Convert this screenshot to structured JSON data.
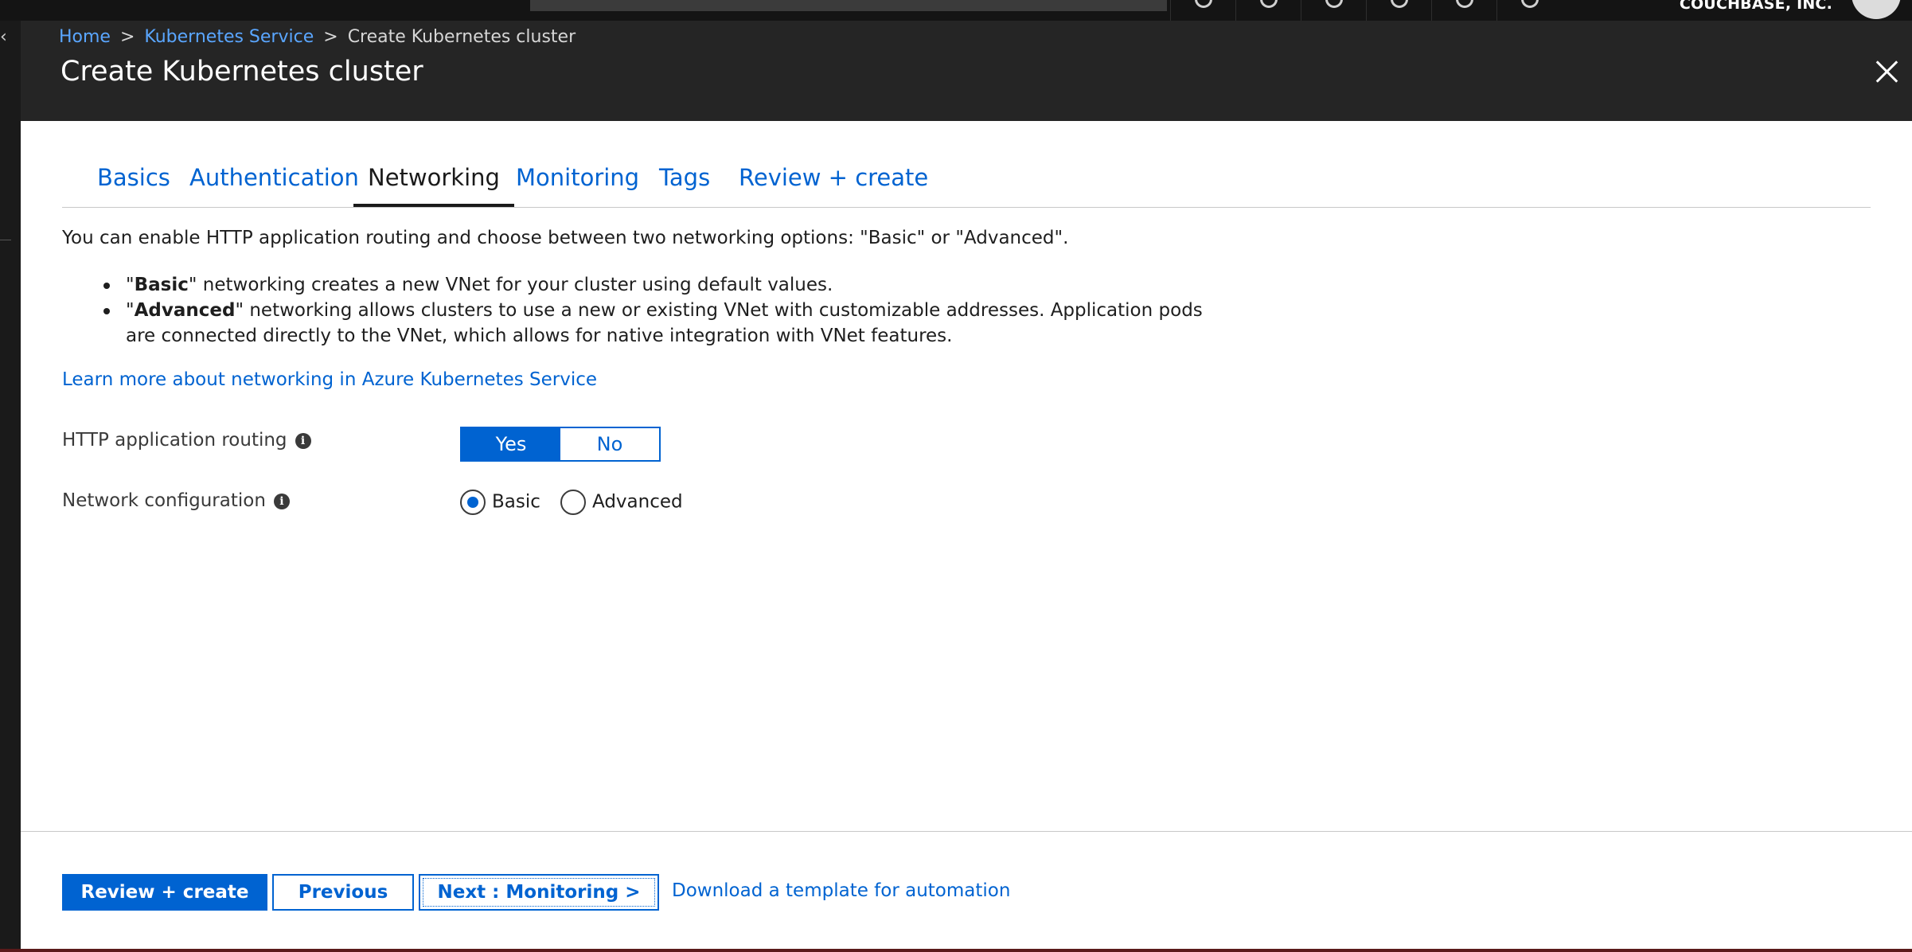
{
  "header": {
    "tenant": "COUCHBASE, INC."
  },
  "breadcrumb": {
    "home": "Home",
    "separator": ">",
    "service": "Kubernetes Service",
    "current": "Create Kubernetes cluster"
  },
  "blade": {
    "title": "Create Kubernetes cluster"
  },
  "tabs": [
    {
      "label": "Basics",
      "active": false
    },
    {
      "label": "Authentication",
      "active": false
    },
    {
      "label": "Networking",
      "active": true
    },
    {
      "label": "Monitoring",
      "active": false
    },
    {
      "label": "Tags",
      "active": false
    },
    {
      "label": "Review + create",
      "active": false
    }
  ],
  "content": {
    "intro": "You can enable HTTP application routing and choose between two networking options: \"Basic\" or \"Advanced\".",
    "bullets": [
      {
        "bold": "Basic",
        "text": " networking creates a new VNet for your cluster using default values."
      },
      {
        "bold": "Advanced",
        "text": " networking allows clusters to use a new or existing VNet with customizable addresses. Application pods are connected directly to the VNet, which allows for native integration with VNet features."
      }
    ],
    "learn_more": "Learn more about networking in Azure Kubernetes Service"
  },
  "form": {
    "http_routing": {
      "label": "HTTP application routing",
      "yes": "Yes",
      "no": "No",
      "selected": "Yes"
    },
    "network_config": {
      "label": "Network configuration",
      "options": [
        "Basic",
        "Advanced"
      ],
      "selected": "Basic"
    }
  },
  "footer": {
    "review_create": "Review + create",
    "previous": "Previous",
    "next": "Next : Monitoring >",
    "download": "Download a template for automation"
  },
  "colors": {
    "accent": "#0063d1",
    "header_bg": "#252525",
    "page_bg": "#ffffff"
  },
  "icons": [
    "chevron-left-icon",
    "close-icon",
    "info-icon",
    "radio-icon"
  ]
}
